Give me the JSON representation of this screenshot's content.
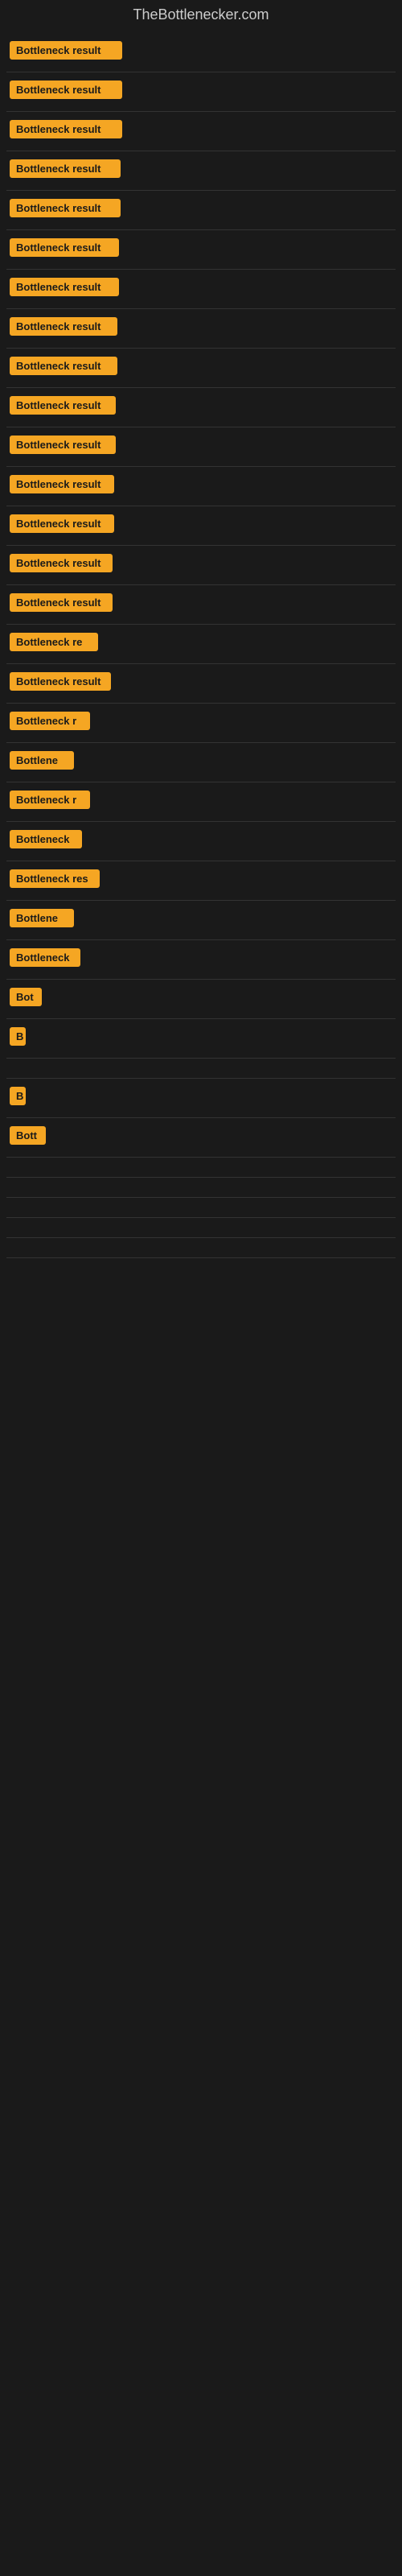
{
  "header": {
    "title": "TheBottlenecker.com"
  },
  "items": [
    {
      "label": "Bottleneck result",
      "width": 140
    },
    {
      "label": "Bottleneck result",
      "width": 140
    },
    {
      "label": "Bottleneck result",
      "width": 140
    },
    {
      "label": "Bottleneck result",
      "width": 138
    },
    {
      "label": "Bottleneck result",
      "width": 138
    },
    {
      "label": "Bottleneck result",
      "width": 136
    },
    {
      "label": "Bottleneck result",
      "width": 136
    },
    {
      "label": "Bottleneck result",
      "width": 134
    },
    {
      "label": "Bottleneck result",
      "width": 134
    },
    {
      "label": "Bottleneck result",
      "width": 132
    },
    {
      "label": "Bottleneck result",
      "width": 132
    },
    {
      "label": "Bottleneck result",
      "width": 130
    },
    {
      "label": "Bottleneck result",
      "width": 130
    },
    {
      "label": "Bottleneck result",
      "width": 128
    },
    {
      "label": "Bottleneck result",
      "width": 128
    },
    {
      "label": "Bottleneck re",
      "width": 110
    },
    {
      "label": "Bottleneck result",
      "width": 126
    },
    {
      "label": "Bottleneck r",
      "width": 100
    },
    {
      "label": "Bottlene",
      "width": 80
    },
    {
      "label": "Bottleneck r",
      "width": 100
    },
    {
      "label": "Bottleneck",
      "width": 90
    },
    {
      "label": "Bottleneck res",
      "width": 112
    },
    {
      "label": "Bottlene",
      "width": 80
    },
    {
      "label": "Bottleneck",
      "width": 88
    },
    {
      "label": "Bot",
      "width": 40
    },
    {
      "label": "B",
      "width": 20
    },
    {
      "label": "",
      "width": 0
    },
    {
      "label": "B",
      "width": 20
    },
    {
      "label": "Bott",
      "width": 45
    },
    {
      "label": "",
      "width": 0
    },
    {
      "label": "",
      "width": 0
    },
    {
      "label": "",
      "width": 0
    },
    {
      "label": "",
      "width": 0
    },
    {
      "label": "",
      "width": 0
    }
  ]
}
